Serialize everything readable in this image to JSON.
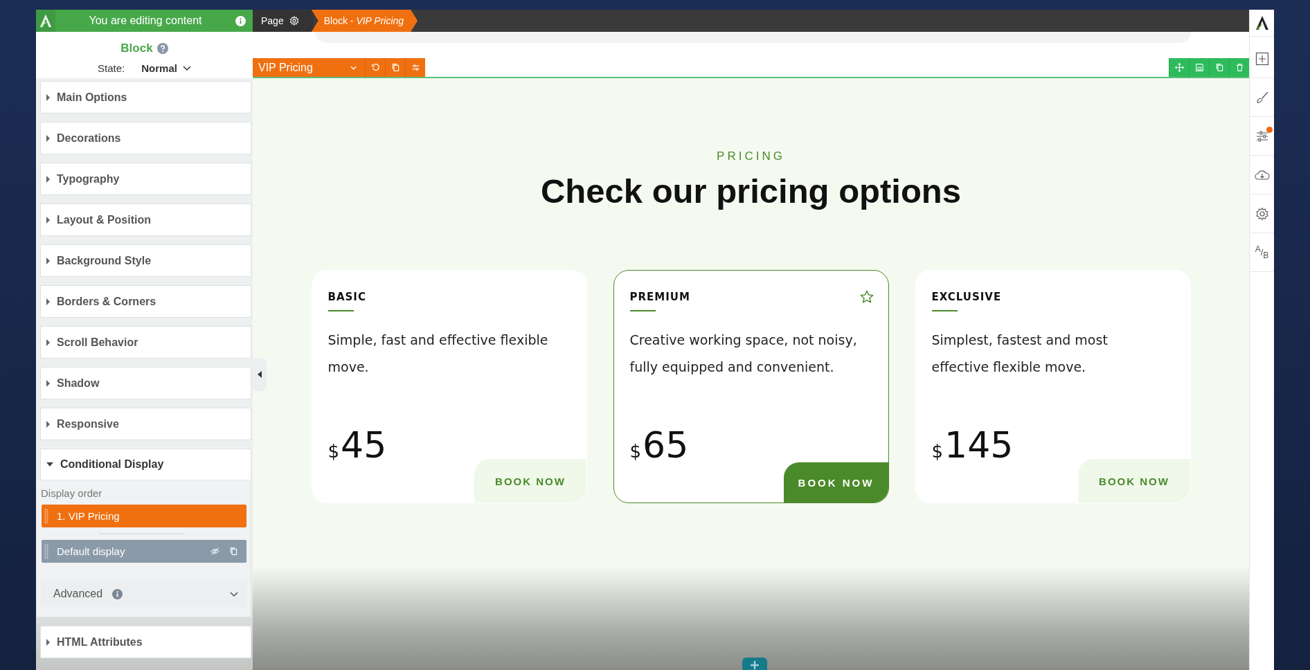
{
  "editor_banner": {
    "text": "You are editing content"
  },
  "breadcrumb": [
    {
      "label": "Page",
      "kind": "page",
      "selected": false
    },
    {
      "label": "Block - *VIP Pricing*",
      "kind": "block",
      "selected": true
    }
  ],
  "panel": {
    "title": "Block",
    "state_label": "State:",
    "state_value": "Normal",
    "sections": [
      {
        "label": "Main Options",
        "expanded": false
      },
      {
        "label": "Decorations",
        "expanded": false
      },
      {
        "label": "Typography",
        "expanded": false
      },
      {
        "label": "Layout & Position",
        "expanded": false
      },
      {
        "label": "Background Style",
        "expanded": false
      },
      {
        "label": "Borders & Corners",
        "expanded": false
      },
      {
        "label": "Scroll Behavior",
        "expanded": false
      },
      {
        "label": "Shadow",
        "expanded": false
      },
      {
        "label": "Responsive",
        "expanded": false
      },
      {
        "label": "Conditional Display",
        "expanded": true,
        "display_order_label": "Display order",
        "display_items": [
          {
            "label": "1. VIP Pricing",
            "selected": true
          },
          {
            "label": "Default display",
            "selected": false
          }
        ],
        "advanced": {
          "label": "Advanced",
          "expanded": false
        }
      },
      {
        "label": "HTML Attributes",
        "expanded": false
      }
    ]
  },
  "block_toolbar": {
    "name": "VIP Pricing"
  },
  "right_toolbar": {
    "ab_label": "$^{A}$/$_{B}$"
  },
  "content": {
    "eyebrow": "PRICING",
    "heading": "Check our pricing options",
    "plans": [
      {
        "name": "BASIC",
        "description": "Simple, fast and effective flexible move.",
        "currency": "$",
        "price": "45",
        "button": "BOOK NOW",
        "featured": false
      },
      {
        "name": "PREMIUM",
        "description": "Creative working space, not noisy, fully equipped and convenient.",
        "currency": "$",
        "price": "65",
        "button": "BOOK NOW",
        "featured": true
      },
      {
        "name": "EXCLUSIVE",
        "description": "Simplest, fastest and most effective flexible move.",
        "currency": "$",
        "price": "145",
        "button": "BOOK NOW",
        "featured": false
      }
    ]
  }
}
